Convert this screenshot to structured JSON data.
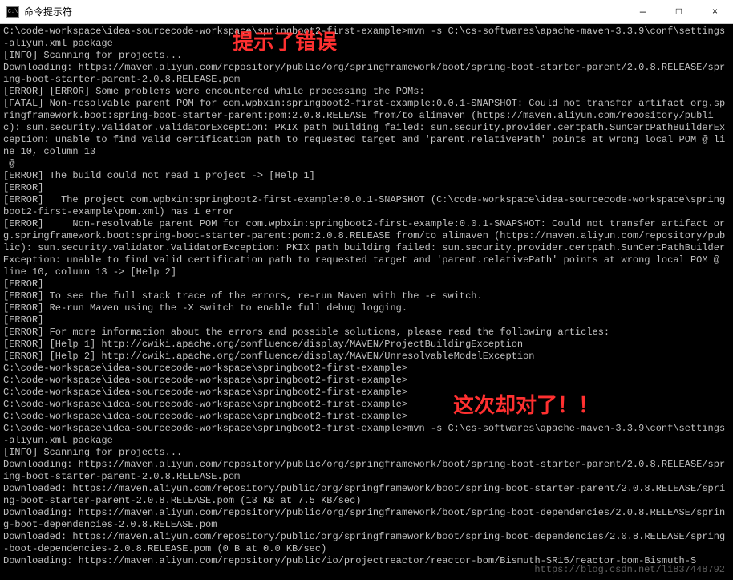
{
  "window": {
    "title": "命令提示符",
    "minimize": "—",
    "maximize": "□",
    "close": "×"
  },
  "annotations": {
    "error_hint": "提示了错误",
    "success_hint": "这次却对了！！"
  },
  "terminal": {
    "lines": [
      "C:\\code-workspace\\idea-sourcecode-workspace\\springboot2-first-example>mvn -s C:\\cs-softwares\\apache-maven-3.3.9\\conf\\settings-aliyun.xml package",
      "[INFO] Scanning for projects...",
      "Downloading: https://maven.aliyun.com/repository/public/org/springframework/boot/spring-boot-starter-parent/2.0.8.RELEASE/spring-boot-starter-parent-2.0.8.RELEASE.pom",
      "[ERROR] [ERROR] Some problems were encountered while processing the POMs:",
      "[FATAL] Non-resolvable parent POM for com.wpbxin:springboot2-first-example:0.0.1-SNAPSHOT: Could not transfer artifact org.springframework.boot:spring-boot-starter-parent:pom:2.0.8.RELEASE from/to alimaven (https://maven.aliyun.com/repository/public): sun.security.validator.ValidatorException: PKIX path building failed: sun.security.provider.certpath.SunCertPathBuilderException: unable to find valid certification path to requested target and 'parent.relativePath' points at wrong local POM @ line 10, column 13",
      " @",
      "[ERROR] The build could not read 1 project -> [Help 1]",
      "[ERROR]",
      "[ERROR]   The project com.wpbxin:springboot2-first-example:0.0.1-SNAPSHOT (C:\\code-workspace\\idea-sourcecode-workspace\\springboot2-first-example\\pom.xml) has 1 error",
      "[ERROR]     Non-resolvable parent POM for com.wpbxin:springboot2-first-example:0.0.1-SNAPSHOT: Could not transfer artifact org.springframework.boot:spring-boot-starter-parent:pom:2.0.8.RELEASE from/to alimaven (https://maven.aliyun.com/repository/public): sun.security.validator.ValidatorException: PKIX path building failed: sun.security.provider.certpath.SunCertPathBuilderException: unable to find valid certification path to requested target and 'parent.relativePath' points at wrong local POM @ line 10, column 13 -> [Help 2]",
      "[ERROR]",
      "[ERROR] To see the full stack trace of the errors, re-run Maven with the -e switch.",
      "[ERROR] Re-run Maven using the -X switch to enable full debug logging.",
      "[ERROR]",
      "[ERROR] For more information about the errors and possible solutions, please read the following articles:",
      "[ERROR] [Help 1] http://cwiki.apache.org/confluence/display/MAVEN/ProjectBuildingException",
      "[ERROR] [Help 2] http://cwiki.apache.org/confluence/display/MAVEN/UnresolvableModelException",
      "",
      "C:\\code-workspace\\idea-sourcecode-workspace\\springboot2-first-example>",
      "C:\\code-workspace\\idea-sourcecode-workspace\\springboot2-first-example>",
      "C:\\code-workspace\\idea-sourcecode-workspace\\springboot2-first-example>",
      "C:\\code-workspace\\idea-sourcecode-workspace\\springboot2-first-example>",
      "C:\\code-workspace\\idea-sourcecode-workspace\\springboot2-first-example>",
      "C:\\code-workspace\\idea-sourcecode-workspace\\springboot2-first-example>mvn -s C:\\cs-softwares\\apache-maven-3.3.9\\conf\\settings-aliyun.xml package",
      "[INFO] Scanning for projects...",
      "Downloading: https://maven.aliyun.com/repository/public/org/springframework/boot/spring-boot-starter-parent/2.0.8.RELEASE/spring-boot-starter-parent-2.0.8.RELEASE.pom",
      "Downloaded: https://maven.aliyun.com/repository/public/org/springframework/boot/spring-boot-starter-parent/2.0.8.RELEASE/spring-boot-starter-parent-2.0.8.RELEASE.pom (13 KB at 7.5 KB/sec)",
      "Downloading: https://maven.aliyun.com/repository/public/org/springframework/boot/spring-boot-dependencies/2.0.8.RELEASE/spring-boot-dependencies-2.0.8.RELEASE.pom",
      "Downloaded: https://maven.aliyun.com/repository/public/org/springframework/boot/spring-boot-dependencies/2.0.8.RELEASE/spring-boot-dependencies-2.0.8.RELEASE.pom (0 B at 0.0 KB/sec)",
      "Downloading: https://maven.aliyun.com/repository/public/io/projectreactor/reactor-bom/Bismuth-SR15/reactor-bom-Bismuth-S"
    ]
  },
  "watermark": "https://blog.csdn.net/li837448792"
}
